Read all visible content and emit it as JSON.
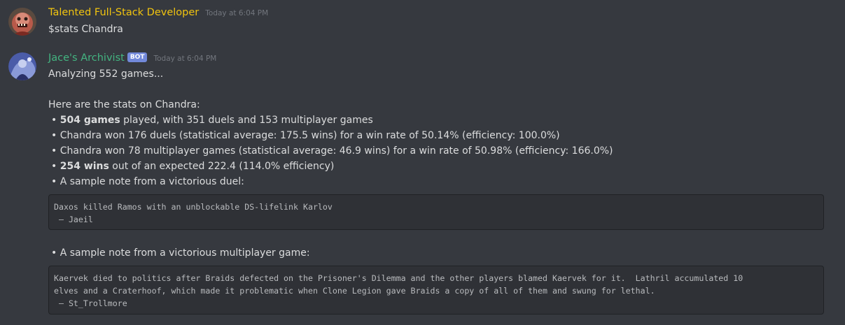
{
  "messages": [
    {
      "username": "Talented Full-Stack Developer",
      "username_color": "#f1c40f",
      "timestamp": "Today at 6:04 PM",
      "avatar": "zombie-avatar-icon",
      "text": "$stats Chandra"
    },
    {
      "username": "Jace's Archivist",
      "username_color": "#43b581",
      "bot_tag": "BOT",
      "timestamp": "Today at 6:04 PM",
      "avatar": "jace-avatar-icon",
      "intro": "Analyzing 552 games...",
      "heading": "Here are the stats on Chandra:",
      "bullets": [
        {
          "bullet": "•",
          "bold": "504 games",
          "rest": " played, with 351 duels and 153 multiplayer games"
        },
        {
          "bullet": "•",
          "bold": "",
          "rest": " Chandra won 176 duels (statistical average: 175.5 wins) for a win rate of 50.14% (efficiency: 100.0%)"
        },
        {
          "bullet": "•",
          "bold": "",
          "rest": " Chandra won 78 multiplayer games (statistical average: 46.9 wins) for a win rate of 50.98% (efficiency: 166.0%)"
        },
        {
          "bullet": "•",
          "bold": "254 wins",
          "rest": " out of an expected 222.4 (114.0% efficiency)"
        },
        {
          "bullet": "•",
          "bold": "",
          "rest": " A sample note from a victorious duel:"
        }
      ],
      "duel_note": "Daxos killed Ramos with an unblockable DS-lifelink Karlov\n — Jaeil",
      "multiplayer_bullet": "•",
      "multiplayer_label": " A sample note from a victorious multiplayer game:",
      "multiplayer_note": "Kaervek died to politics after Braids defected on the Prisoner's Dilemma and the other players blamed Kaervek for it.  Lathril accumulated 10\nelves and a Craterhoof, which made it problematic when Clone Legion gave Braids a copy of all of them and swung for lethal.\n — St_Trollmore"
    }
  ],
  "colors": {
    "background": "#36393f",
    "code_background": "#2f3136",
    "text": "#dcddde",
    "timestamp": "#72767d",
    "bot_tag": "#7289da"
  }
}
